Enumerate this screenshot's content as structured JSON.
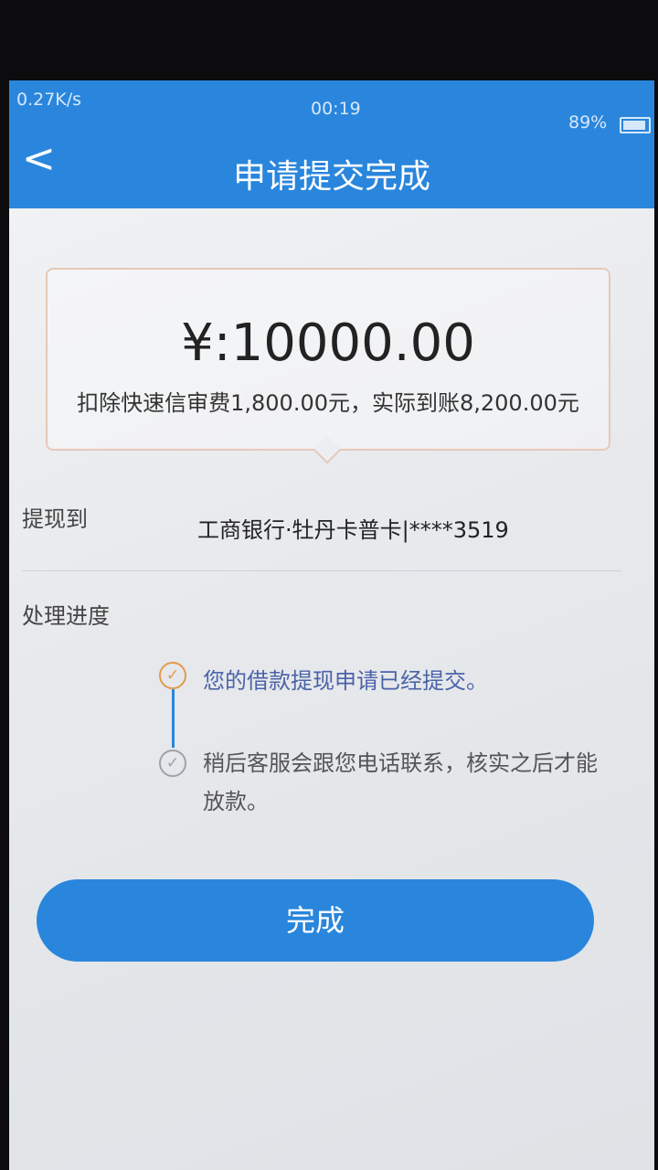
{
  "status_bar": {
    "network_speed": "0.27K/s",
    "time": "00:19",
    "battery": "89%"
  },
  "header": {
    "back_icon": "<",
    "title": "申请提交完成"
  },
  "amount_card": {
    "amount": "¥:10000.00",
    "fee_note": "扣除快速信审费1,800.00元，实际到账8,200.00元"
  },
  "withdraw": {
    "label": "提现到",
    "account": "工商银行·牡丹卡普卡|****3519"
  },
  "progress": {
    "label": "处理进度",
    "steps": [
      {
        "text": "您的借款提现申请已经提交。",
        "state": "done",
        "icon": "check-circle-icon"
      },
      {
        "text": "稍后客服会跟您电话联系，核实之后才能放款。",
        "state": "pending",
        "icon": "check-circle-icon"
      }
    ]
  },
  "done_button": {
    "label": "完成"
  },
  "colors": {
    "brand": "#2a86dc",
    "step_done": "#e39a4b",
    "step_pending": "#9ea3a9",
    "step_text_done": "#4a63a8"
  }
}
